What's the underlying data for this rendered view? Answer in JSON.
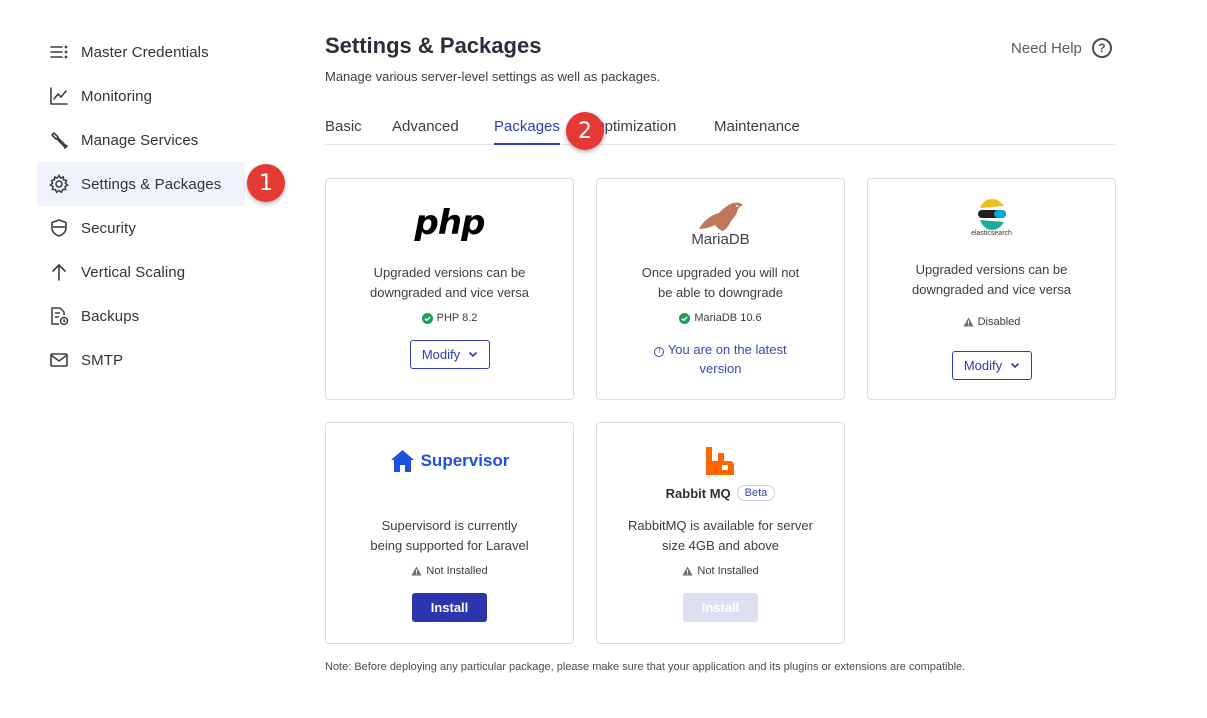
{
  "sidebar": {
    "items": [
      {
        "label": "Master Credentials",
        "icon": "list-icon"
      },
      {
        "label": "Monitoring",
        "icon": "chart-icon"
      },
      {
        "label": "Manage Services",
        "icon": "wrench-icon"
      },
      {
        "label": "Settings & Packages",
        "icon": "gear-icon",
        "active": true
      },
      {
        "label": "Security",
        "icon": "shield-icon"
      },
      {
        "label": "Vertical Scaling",
        "icon": "arrow-up-icon"
      },
      {
        "label": "Backups",
        "icon": "backup-icon"
      },
      {
        "label": "SMTP",
        "icon": "mail-icon"
      }
    ]
  },
  "annotations": {
    "step1": "1",
    "step2": "2",
    "color": "#e53935"
  },
  "header": {
    "title": "Settings & Packages",
    "subtitle": "Manage various server-level settings as well as packages.",
    "help_label": "Need Help",
    "help_icon": "?"
  },
  "tabs": [
    "Basic",
    "Advanced",
    "Packages",
    "Optimization",
    "Maintenance"
  ],
  "active_tab": "Packages",
  "cards": {
    "php": {
      "logo": "php",
      "description_line1": "Upgraded versions can be",
      "description_line2": "downgraded and vice versa",
      "status": "PHP 8.2",
      "button": "Modify"
    },
    "mariadb": {
      "logo": "MariaDB",
      "description_line1": "Once upgraded you will not",
      "description_line2": "be able to downgrade",
      "status": "MariaDB 10.6",
      "latest_line1": "You are on the latest",
      "latest_line2": "version"
    },
    "elasticsearch": {
      "logo": "elasticsearch",
      "description_line1": "Upgraded versions can be",
      "description_line2": "downgraded and vice versa",
      "status": "Disabled",
      "button": "Modify"
    },
    "supervisor": {
      "logo": "Supervisor",
      "description_line1": "Supervisord is currently",
      "description_line2": "being supported for Laravel",
      "status": "Not Installed",
      "button": "Install"
    },
    "rabbitmq": {
      "logo": "Rabbit MQ",
      "badge": "Beta",
      "description_line1": "RabbitMQ is available for server",
      "description_line2": "size 4GB and above",
      "status": "Not Installed",
      "button": "Install"
    }
  },
  "note": "Note: Before deploying any particular package, please make sure that your application and its plugins or extensions are compatible.",
  "colors": {
    "accent": "#2f3bb0",
    "success": "#1e9e5a",
    "rabbit": "#ff6600",
    "supervisor": "#1d4fe0"
  }
}
